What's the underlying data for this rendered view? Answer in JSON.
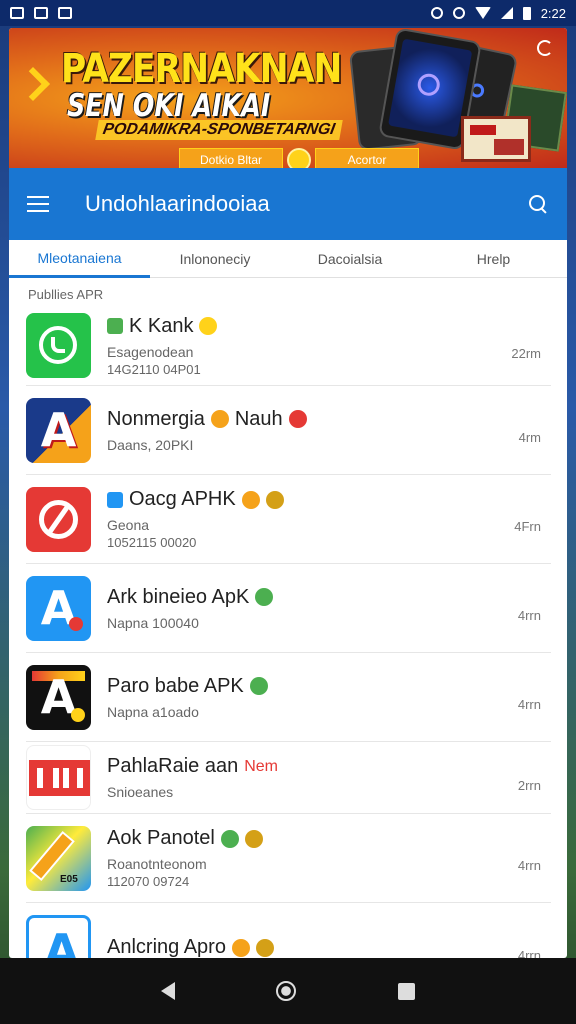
{
  "status_bar": {
    "time": "2:22",
    "icons_left": [
      "notification-icon",
      "message-icon",
      "image-icon"
    ],
    "icons_right": [
      "alarm-icon",
      "data-saver-icon",
      "wifi-icon",
      "signal-icon",
      "battery-icon"
    ]
  },
  "banner": {
    "title": "PAZERNAKNAN",
    "subtitle": "SEN OKI AIKAI",
    "tagline": "PODAMIKRA-SPONBETARNGI",
    "btn_left": "Dotkio Bltar",
    "btn_right": "Acortor"
  },
  "appbar": {
    "title": "Undohlaarindooiaa"
  },
  "tabs": [
    {
      "label": "Mleotanaiena",
      "active": true
    },
    {
      "label": "Inlononeciy",
      "active": false
    },
    {
      "label": "Dacoialsia",
      "active": false
    },
    {
      "label": "Hrelp",
      "active": false
    }
  ],
  "section_label": "Publlies APR",
  "apps": [
    {
      "name": "K Kank",
      "sub": "Esagenodean",
      "sub2": "14G2110 04P01",
      "meta": "22rm",
      "icon": "whatsapp-icon",
      "badges": [
        "#ffd21a"
      ]
    },
    {
      "name": "Nonmergia",
      "name2": "Nauh",
      "sub": "Daans, 20PKI",
      "sub2": "",
      "meta": "4rm",
      "icon": "a-letter-icon",
      "badges": [
        "#f5a21a",
        "#e53935"
      ]
    },
    {
      "name": "Oacg APHK",
      "sub": "Geona",
      "sub2": "1052115 00020",
      "meta": "4Frn",
      "icon": "red-circle-icon",
      "badges": [
        "#f5a21a",
        "#d4a017"
      ]
    },
    {
      "name": "Ark bineieo ApK",
      "sub": "Napna 100040",
      "sub2": "",
      "meta": "4rrn",
      "icon": "blue-a-icon",
      "badges": [
        "#4caf50"
      ]
    },
    {
      "name": "Paro babe APK",
      "sub": "Napna a1oado",
      "sub2": "",
      "meta": "4rrn",
      "icon": "dark-a-icon",
      "badges": [
        "#4caf50"
      ]
    },
    {
      "name": "PahlaRaie aan",
      "name_new": "Nem",
      "sub": "Snioeanes",
      "sub2": "",
      "meta": "2rrn",
      "icon": "red-bars-icon",
      "badges": []
    },
    {
      "name": "Aok Panotel",
      "sub": "Roanotnteonom",
      "sub2": "112070 09724",
      "meta": "4rrn",
      "icon": "pencil-icon",
      "badges": [
        "#4caf50",
        "#d4a017"
      ],
      "icon_tag": "E05"
    },
    {
      "name": "Anlcring Apro",
      "sub": "",
      "sub2": "",
      "meta": "4rrn",
      "icon": "outline-a-icon",
      "badges": [
        "#f5a21a",
        "#d4a017"
      ]
    }
  ],
  "icon_letters": {
    "a": "A"
  },
  "colors": {
    "primary": "#1976d2",
    "status_bar": "#0d2a6a",
    "new_badge": "#e53935"
  }
}
